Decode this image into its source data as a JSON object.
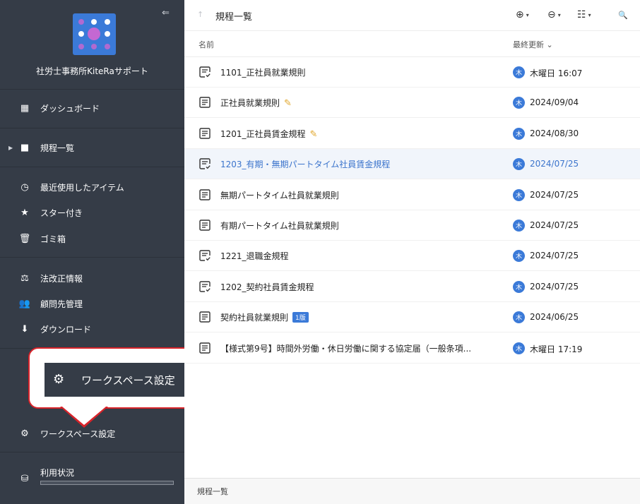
{
  "sidebar": {
    "collapse_icon": "⇐",
    "org_name": "社労士事務所KiteRaサポート",
    "colors": {
      "background": "#353c47",
      "logo": "#3b7ad8",
      "logo_accent": "#c468d2"
    },
    "items": [
      {
        "icon": "dashboard-icon",
        "glyph": "▦",
        "label": "ダッシュボード"
      },
      {
        "icon": "folder-icon",
        "glyph": "■",
        "label": "規程一覧"
      },
      {
        "icon": "clock-icon",
        "glyph": "◷",
        "label": "最近使用したアイテム"
      },
      {
        "icon": "star-icon",
        "glyph": "★",
        "label": "スター付き"
      },
      {
        "icon": "trash-icon",
        "glyph": "🗑",
        "label": "ゴミ箱"
      },
      {
        "icon": "scale-icon",
        "glyph": "⚖",
        "label": "法改正情報"
      },
      {
        "icon": "people-icon",
        "glyph": "👥",
        "label": "顧問先管理"
      },
      {
        "icon": "download-icon",
        "glyph": "⬇",
        "label": "ダウンロード"
      },
      {
        "icon": "gear-icon",
        "glyph": "⚙",
        "label": "ワークスペース設定"
      },
      {
        "icon": "database-icon",
        "glyph": "⛁",
        "label": "利用状況"
      }
    ]
  },
  "callout": {
    "icon": "gear-icon",
    "glyph": "⚙",
    "label": "ワークスペース設定",
    "border_color": "#d8232a"
  },
  "header": {
    "up_icon": "↑",
    "title": "規程一覧",
    "tools": [
      {
        "icon": "add-circle-icon",
        "glyph": "⊕",
        "caret": "▾"
      },
      {
        "icon": "more-circle-icon",
        "glyph": "⊖",
        "caret": "▾"
      },
      {
        "icon": "filter-settings-icon",
        "glyph": "☷",
        "caret": "▾"
      },
      {
        "icon": "search-icon",
        "glyph": "🔍"
      }
    ]
  },
  "columns": {
    "name": "名前",
    "updated": "最終更新",
    "sort_icon": "⌄"
  },
  "files": [
    {
      "name": "1101_正社員就業規則",
      "icon": "doc-check-icon",
      "date": "木曜日 16:07",
      "avatar": "木"
    },
    {
      "name": "正社員就業規則",
      "icon": "doc-icon",
      "date": "2024/09/04",
      "avatar": "木",
      "edit_mark": "✎"
    },
    {
      "name": "1201_正社員賃金規程",
      "icon": "doc-icon",
      "date": "2024/08/30",
      "avatar": "木",
      "edit_mark": "✎"
    },
    {
      "name": "1203_有期・無期パートタイム社員賃金規程",
      "icon": "doc-check-icon",
      "date": "2024/07/25",
      "avatar": "木",
      "selected": true
    },
    {
      "name": "無期パートタイム社員就業規則",
      "icon": "doc-icon",
      "date": "2024/07/25",
      "avatar": "木"
    },
    {
      "name": "有期パートタイム社員就業規則",
      "icon": "doc-icon",
      "date": "2024/07/25",
      "avatar": "木"
    },
    {
      "name": "1221_退職金規程",
      "icon": "doc-check-icon",
      "date": "2024/07/25",
      "avatar": "木"
    },
    {
      "name": "1202_契約社員賃金規程",
      "icon": "doc-check-icon",
      "date": "2024/07/25",
      "avatar": "木"
    },
    {
      "name": "契約社員就業規則",
      "icon": "doc-icon",
      "date": "2024/06/25",
      "avatar": "木",
      "badge": "1版"
    },
    {
      "name": "【様式第9号】時間外労働・休日労働に関する協定届（一般条項...",
      "icon": "doc-icon",
      "date": "木曜日 17:19",
      "avatar": "木"
    }
  ],
  "footer": {
    "label": "規程一覧"
  },
  "accent": "#3b7ad8"
}
